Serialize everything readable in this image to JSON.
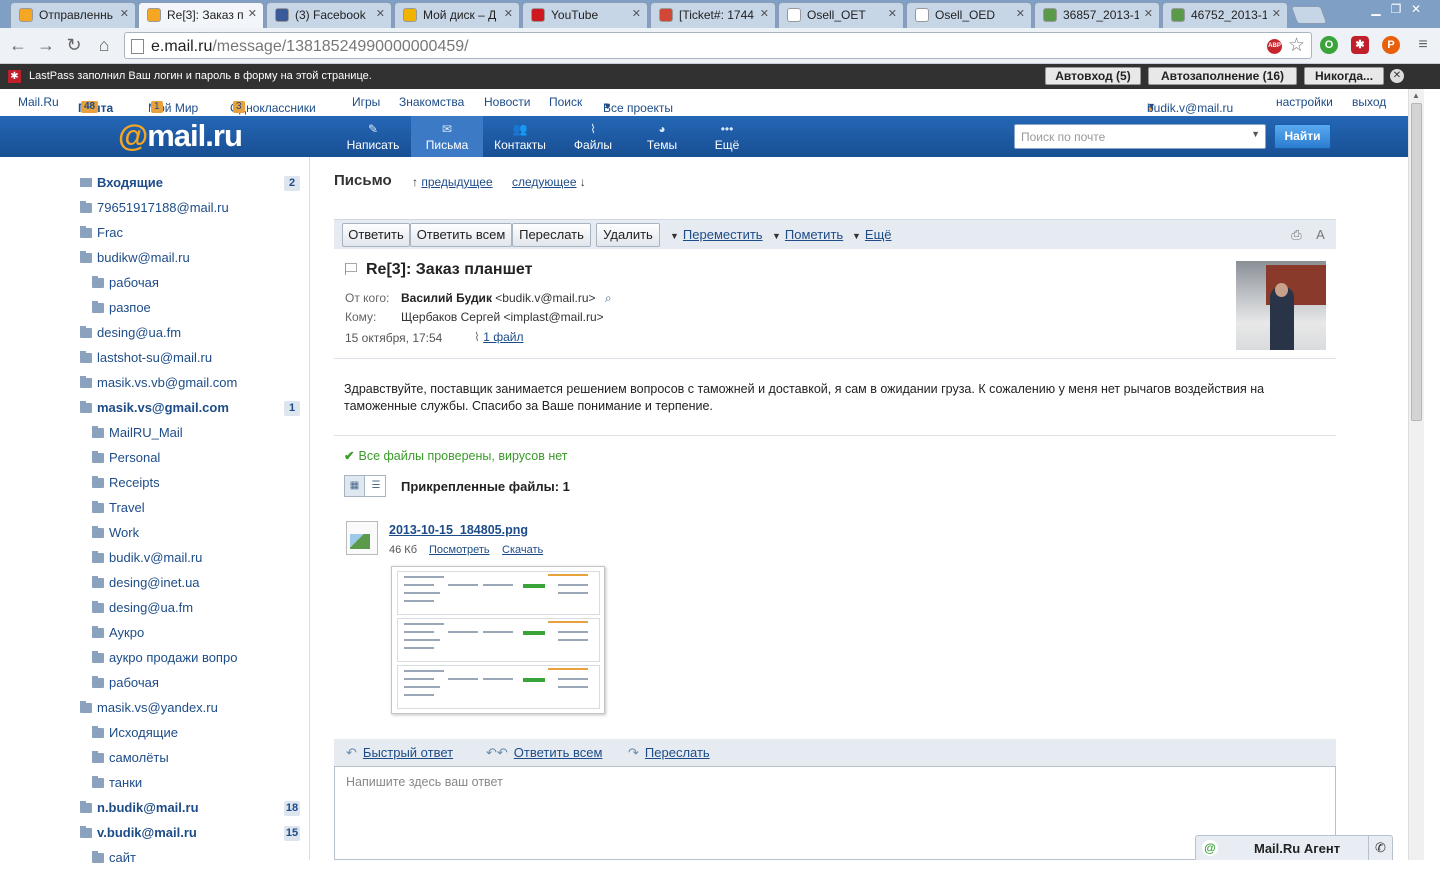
{
  "browser": {
    "tabs": [
      {
        "label": "Отправленнь",
        "favicon": "mailru-icon",
        "color": "#f5a623"
      },
      {
        "label": "Re[3]: Заказ п",
        "favicon": "mailru-icon",
        "color": "#f5a623"
      },
      {
        "label": "(3) Facebook",
        "favicon": "facebook-icon",
        "color": "#3b5998"
      },
      {
        "label": "Мой диск – Д",
        "favicon": "gdrive-icon",
        "color": "#f0b400"
      },
      {
        "label": "YouTube",
        "favicon": "youtube-icon",
        "color": "#cc181e"
      },
      {
        "label": "[Ticket#: 1744",
        "favicon": "gmail-icon",
        "color": "#d14836"
      },
      {
        "label": "Osell_OET",
        "favicon": "doc-icon",
        "color": "#ffffff"
      },
      {
        "label": "Osell_OED",
        "favicon": "doc-icon",
        "color": "#ffffff"
      },
      {
        "label": "36857_2013-1(",
        "favicon": "image-icon",
        "color": "#5a9a4a"
      },
      {
        "label": "46752_2013-1(",
        "favicon": "image-icon",
        "color": "#5a9a4a"
      }
    ],
    "url_host": "e.mail.ru",
    "url_path": "/message/13818524990000000459/",
    "abp_label": "ABP"
  },
  "lastpass": {
    "message": "LastPass заполнил Ваш логин и пароль в форму на этой странице.",
    "autologin": "Автовход (5)",
    "autofill": "Автозаполнение (16)",
    "never": "Никогда..."
  },
  "portal": {
    "mailru": "Mail.Ru",
    "pochta": "Почта",
    "pochta_count": "48",
    "moimir": "Мой Мир",
    "moimir_count": "1",
    "ok": "Одноклассники",
    "ok_count": "3",
    "games": "Игры",
    "dating": "Знакомства",
    "news": "Новости",
    "search": "Поиск",
    "projects": "Все проекты",
    "user": "budik.v@mail.ru",
    "settings": "настройки",
    "logout": "выход"
  },
  "header": {
    "logo_at": "@",
    "logo_text": "mail.ru",
    "nav": [
      {
        "label": "Написать",
        "icon": "pencil-icon"
      },
      {
        "label": "Письма",
        "icon": "envelope-icon"
      },
      {
        "label": "Контакты",
        "icon": "contacts-icon"
      },
      {
        "label": "Файлы",
        "icon": "paperclip-icon"
      },
      {
        "label": "Темы",
        "icon": "palette-icon"
      },
      {
        "label": "Ещё",
        "icon": "more-icon"
      }
    ],
    "search_placeholder": "Поиск по почте",
    "search_button": "Найти"
  },
  "sidebar": {
    "folders": [
      {
        "label": "Входящие",
        "count": "2",
        "bold": true,
        "level": 0
      },
      {
        "label": "79651917188@mail.ru",
        "level": 0
      },
      {
        "label": "Frac",
        "level": 0
      },
      {
        "label": "budikw@mail.ru",
        "level": 0
      },
      {
        "label": "рабочая",
        "level": 1
      },
      {
        "label": "разпое",
        "level": 1
      },
      {
        "label": "desing@ua.fm",
        "level": 0
      },
      {
        "label": "lastshot-su@mail.ru",
        "level": 0
      },
      {
        "label": "masik.vs.vb@gmail.com",
        "level": 0
      },
      {
        "label": "masik.vs@gmail.com",
        "count": "1",
        "bold": true,
        "level": 0
      },
      {
        "label": "MailRU_Mail",
        "level": 1
      },
      {
        "label": "Personal",
        "level": 1
      },
      {
        "label": "Receipts",
        "level": 1
      },
      {
        "label": "Travel",
        "level": 1
      },
      {
        "label": "Work",
        "level": 1
      },
      {
        "label": "budik.v@mail.ru",
        "level": 1
      },
      {
        "label": "desing@inet.ua",
        "level": 1
      },
      {
        "label": "desing@ua.fm",
        "level": 1
      },
      {
        "label": "Аукро",
        "level": 1
      },
      {
        "label": "аукро продажи вопро",
        "level": 1
      },
      {
        "label": "рабочая",
        "level": 1
      },
      {
        "label": "masik.vs@yandex.ru",
        "level": 0
      },
      {
        "label": "Исходящие",
        "level": 1
      },
      {
        "label": "самолёты",
        "level": 1
      },
      {
        "label": "танки",
        "level": 1
      },
      {
        "label": "n.budik@mail.ru",
        "count": "18",
        "bold": true,
        "level": 0
      },
      {
        "label": "v.budik@mail.ru",
        "count": "15",
        "bold": true,
        "level": 0
      },
      {
        "label": "сайт",
        "level": 1
      }
    ]
  },
  "message": {
    "page_title": "Письмо",
    "prev": "предыдущее",
    "next": "следующее",
    "toolbar": {
      "reply": "Ответить",
      "reply_all": "Ответить всем",
      "forward": "Переслать",
      "delete": "Удалить",
      "move": "Переместить",
      "mark": "Пометить",
      "more": "Ещё"
    },
    "subject": "Re[3]: Заказ планшет",
    "from_label": "От кого:",
    "from_name": "Василий Будик",
    "from_email": "<budik.v@mail.ru>",
    "to_label": "Кому:",
    "to": "Щербаков Сергей <implast@mail.ru>",
    "date": "15 октября, 17:54",
    "attachments_link": "1 файл",
    "body": "Здравствуйте, поставщик занимается решением вопросов с таможней и доставкой, я сам в ожидании груза.  К сожалению у меня нет рычагов воздействия на таможенные службы. Спасибо за Ваше понимание и терпение.",
    "virus_status": "Все файлы проверены, вирусов нет",
    "attachments_title": "Прикрепленные файлы: 1",
    "file": {
      "name": "2013-10-15_184805.png",
      "size": "46 Кб",
      "view": "Посмотреть",
      "download": "Скачать"
    },
    "reply_bar": {
      "quick": "Быстрый ответ",
      "all": "Ответить всем",
      "forward": "Переслать"
    },
    "reply_placeholder": "Напишите здесь ваш ответ"
  },
  "agent": {
    "title": "Mail.Ru Агент"
  }
}
